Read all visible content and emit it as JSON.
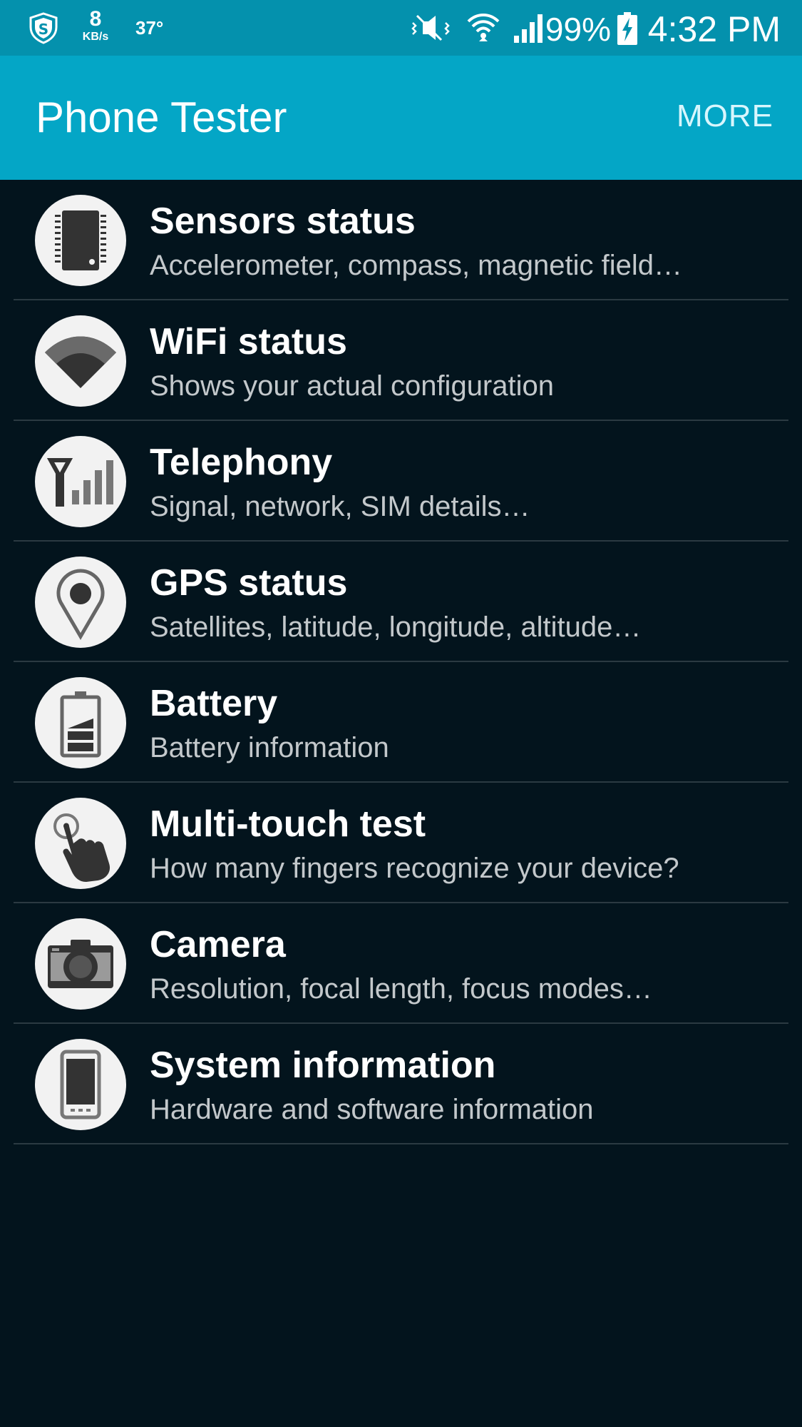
{
  "status_bar": {
    "net_speed_value": "8",
    "net_speed_unit": "KB/s",
    "temperature": "37°",
    "battery_percent": "99%",
    "clock": "4:32 PM",
    "icons": [
      "shield-icon",
      "mute-icon",
      "wifi-icon",
      "signal-icon",
      "battery-charging-icon"
    ],
    "color": "#0491ad"
  },
  "app_bar": {
    "title": "Phone Tester",
    "more_label": "MORE",
    "color": "#04a6c6"
  },
  "items": [
    {
      "title": "Sensors status",
      "subtitle": "Accelerometer, compass, magnetic field…",
      "icon": "chip-icon"
    },
    {
      "title": "WiFi status",
      "subtitle": "Shows your actual configuration",
      "icon": "wifi-wedge-icon"
    },
    {
      "title": "Telephony",
      "subtitle": "Signal, network, SIM details…",
      "icon": "antenna-signal-icon"
    },
    {
      "title": "GPS status",
      "subtitle": "Satellites, latitude, longitude, altitude…",
      "icon": "location-pin-icon"
    },
    {
      "title": "Battery",
      "subtitle": "Battery information",
      "icon": "battery-icon"
    },
    {
      "title": "Multi-touch test",
      "subtitle": "How many fingers recognize your device?",
      "icon": "touch-hand-icon"
    },
    {
      "title": "Camera",
      "subtitle": "Resolution, focal length, focus modes…",
      "icon": "camera-icon"
    },
    {
      "title": "System information",
      "subtitle": "Hardware and software information",
      "icon": "smartphone-icon"
    }
  ],
  "colors": {
    "background": "#03141d",
    "icon_circle": "#f2f2f2",
    "icon_glyph": "#333333",
    "title_text": "#ffffff",
    "subtitle_text": "#c3c8cb",
    "divider": "#2b3a42"
  }
}
